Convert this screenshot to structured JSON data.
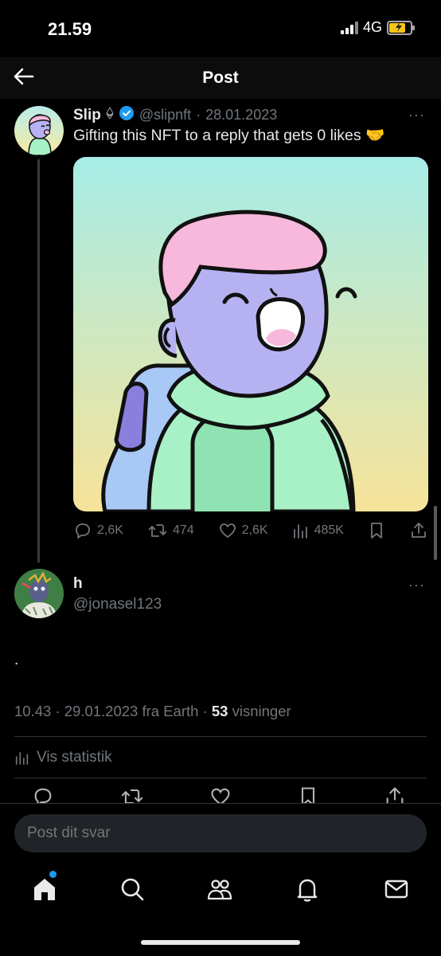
{
  "status_bar": {
    "time": "21.59",
    "network": "4G"
  },
  "header": {
    "title": "Post"
  },
  "tweet": {
    "author_name": "Slip",
    "handle": "@slipnft",
    "separator": "·",
    "date": "28.01.2023",
    "more": "···",
    "text": "Gifting this NFT to a reply that gets 0 likes 🤝",
    "stats": {
      "replies": "2,6K",
      "retweets": "474",
      "likes": "2,6K",
      "views": "485K"
    }
  },
  "reply": {
    "name": "h",
    "handle": "@jonasel123",
    "more": "···",
    "text": ".",
    "time": "10.43",
    "date": "29.01.2023",
    "source_prefix": "fra",
    "source": "Earth",
    "views_count": "53",
    "views_label": "visninger",
    "stats_label": "Vis statistik"
  },
  "composer": {
    "placeholder": "Post dit svar"
  },
  "colors": {
    "accent": "#1d9bf0",
    "background": "#000000",
    "muted": "#71767b"
  }
}
